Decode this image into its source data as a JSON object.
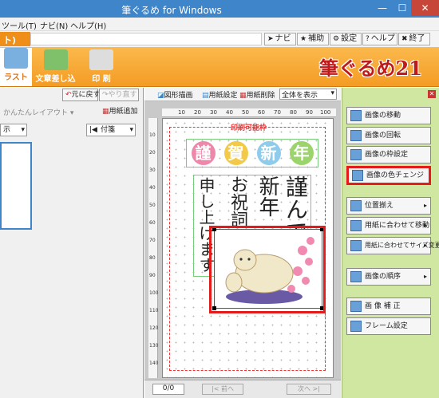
{
  "window": {
    "title": "筆ぐるめ for Windows",
    "min": "—",
    "max": "☐",
    "close": "✕"
  },
  "menu": [
    "ツール(T)",
    "ナビ(N)",
    "ヘルプ(H)"
  ],
  "topbar": {
    "tab_fragment": "ト)",
    "buttons": [
      "ナビ",
      "補助",
      "設定",
      "ヘルプ",
      "終了"
    ]
  },
  "ribbon": {
    "tabs": [
      "ラスト",
      "文章差し込み",
      "印 刷"
    ],
    "logo": "筆ぐるめ21"
  },
  "left": {
    "undo": "元に戻す",
    "redo": "やり直す",
    "easy_layout": "かんたんレイアウト",
    "add_sheet": "用紙追加",
    "display_fragment": "示",
    "fusen": "付箋"
  },
  "canvas_toolbar": {
    "shape_draw": "図形描画",
    "sheet_settings": "用紙設定",
    "sheet_delete": "用紙削除",
    "view_select": "全体を表示"
  },
  "ruler_h": [
    "10",
    "20",
    "30",
    "40",
    "50",
    "60",
    "70",
    "80",
    "90",
    "100"
  ],
  "ruler_v": [
    "10",
    "20",
    "30",
    "40",
    "50",
    "60",
    "70",
    "80",
    "90",
    "100",
    "110",
    "120",
    "130",
    "140"
  ],
  "card": {
    "print_area": "印刷可能枠",
    "greeting_chars": [
      "謹",
      "賀",
      "新",
      "年"
    ],
    "poem_left": "申し上げます",
    "poem_mid": "お祝詞",
    "poem_right1": "新年",
    "poem_right2": "謹んで"
  },
  "status": {
    "page": "0/0",
    "prev": "前へ",
    "next": "次へ"
  },
  "right": {
    "buttons": [
      "画像の移動",
      "画像の回転",
      "画像の枠設定",
      "画像の色チェンジ",
      "位置揃え",
      "用紙に合わせて移動",
      "用紙に合わせてサイズ変更",
      "画像の順序",
      "画 像 補 正",
      "フレーム設定"
    ]
  },
  "colors": {
    "title_bar": "#3e85c9",
    "ribbon": "#f49c24",
    "right_panel": "#cfe7a0",
    "highlight": "#e51b1b"
  }
}
